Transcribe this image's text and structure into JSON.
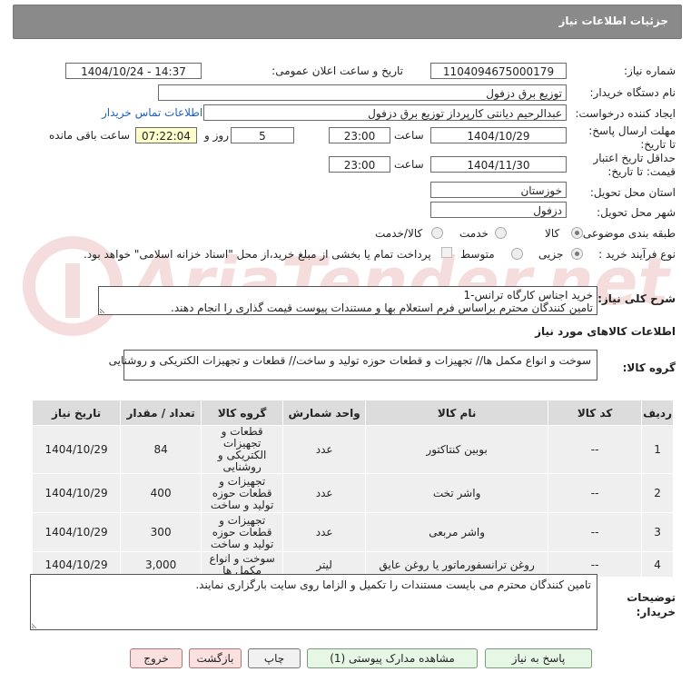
{
  "header": {
    "title": "جزئیات اطلاعات نیاز"
  },
  "form": {
    "need_number_label": "شماره نیاز:",
    "need_number": "1104094675000179",
    "announce_label": "تاریخ و ساعت اعلان عمومی:",
    "announce_value": "1404/10/24 - 14:37",
    "buyer_org_label": "نام دستگاه خریدار:",
    "buyer_org": "توزیع برق دزفول",
    "creator_label": "ایجاد کننده درخواست:",
    "creator": "عبدالرحیم دیانتی کارپرداز توزیع برق دزفول",
    "contact_link": "اطلاعات تماس خریدار",
    "deadline_label": "مهلت ارسال پاسخ: تا تاریخ:",
    "deadline_date": "1404/10/29",
    "time_label": "ساعت",
    "deadline_time": "23:00",
    "days": "5",
    "days_label": "روز و",
    "remaining_time": "07:22:04",
    "remaining_label": "ساعت باقی مانده",
    "validity_label": "حداقل تاریخ اعتبار قیمت: تا تاریخ:",
    "validity_date": "1404/11/30",
    "validity_time": "23:00",
    "province_label": "استان محل تحویل:",
    "province": "خوزستان",
    "city_label": "شهر محل تحویل:",
    "city": "دزفول",
    "category_label": "طبقه بندی موضوعی:",
    "category_options": [
      "کالا",
      "خدمت",
      "کالا/خدمت"
    ],
    "category_selected": "کالا",
    "process_label": "نوع فرآیند خرید :",
    "process_options": [
      "جزیی",
      "متوسط"
    ],
    "process_selected": "جزیی",
    "payment_text": "پرداخت تمام یا بخشی از مبلغ خرید،از محل \"اسناد خزانه اسلامی\" خواهد بود.",
    "overall_desc_label": "شرح کلی نیاز:",
    "overall_desc_line1": "خرید اجناس کارگاه ترانس-1",
    "overall_desc_line2": "تامین کنندگان محترم براساس فرم استعلام بها و مستندات پیوست قیمت گذاری را انجام دهند.",
    "goods_info_title": "اطلاعات کالاهای مورد نیاز",
    "goods_group_label": "گروه کالا:",
    "goods_group": "سوخت و انواع مکمل ها// تجهیزات و قطعات حوزه تولید و ساخت// قطعات و تجهیزات الکتریکی و روشنایی",
    "buyer_notes_label": "توضیحات خریدار:",
    "buyer_notes": "تامین کنندگان محترم می بایست مستندات را تکمیل و الزاما روی سایت بارگزاری نمایند."
  },
  "table": {
    "headers": [
      "ردیف",
      "کد کالا",
      "نام کالا",
      "واحد شمارش",
      "گروه کالا",
      "تعداد / مقدار",
      "تاریخ نیاز"
    ],
    "rows": [
      [
        "1",
        "--",
        "بوبین کنتاکتور",
        "عدد",
        "قطعات و تجهیزات الکتریکی و روشنایی",
        "84",
        "1404/10/29"
      ],
      [
        "2",
        "--",
        "واشر تخت",
        "عدد",
        "تجهیزات و قطعات حوزه تولید و ساخت",
        "400",
        "1404/10/29"
      ],
      [
        "3",
        "--",
        "واشر مربعی",
        "عدد",
        "تجهیزات و قطعات حوزه تولید و ساخت",
        "300",
        "1404/10/29"
      ],
      [
        "4",
        "--",
        "روغن ترانسفورماتور یا روغن عایق",
        "لیتر",
        "سوخت و انواع مکمل ها",
        "3,000",
        "1404/10/29"
      ]
    ]
  },
  "buttons": {
    "reply": "پاسخ به نیاز",
    "attachments": "مشاهده مدارک پیوستی (1)",
    "print": "چاپ",
    "back": "بازگشت",
    "exit": "خروج"
  },
  "watermark": {
    "text": "AriaTender.net"
  },
  "colors": {
    "header_bg": "#8a8a8a",
    "link": "#1f5fbf",
    "remaining_bg": "#ffffcc",
    "table_header_bg": "#dcdcdc",
    "table_row_bg": "#efefef"
  }
}
